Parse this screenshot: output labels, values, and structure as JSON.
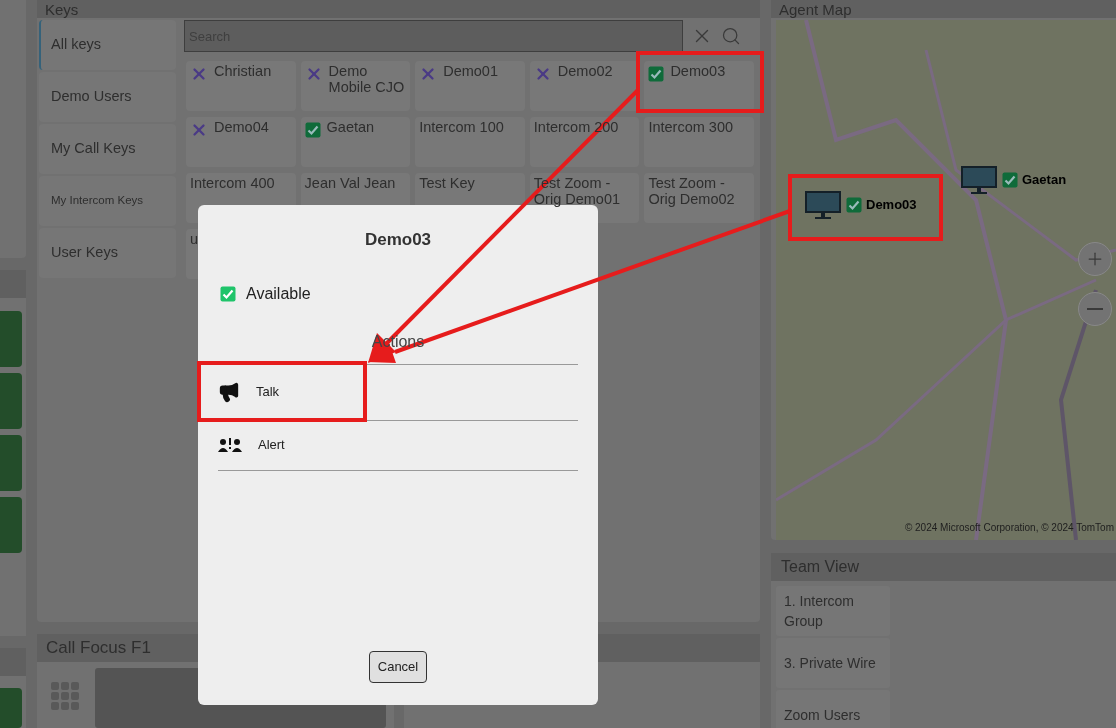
{
  "keys_panel": {
    "title": "Keys",
    "categories": [
      {
        "label": "All keys",
        "selected": true
      },
      {
        "label": "Demo Users",
        "selected": false
      },
      {
        "label": "My Call Keys",
        "selected": false
      },
      {
        "label": "My Intercom Keys",
        "selected": false
      },
      {
        "label": "User Keys",
        "selected": false
      }
    ],
    "search": {
      "placeholder": "Search"
    },
    "keys": [
      {
        "label": "Christian",
        "kind": "unavailable"
      },
      {
        "label": "Demo Mobile CJO",
        "kind": "unavailable"
      },
      {
        "label": "Demo01",
        "kind": "unavailable"
      },
      {
        "label": "Demo02",
        "kind": "unavailable"
      },
      {
        "label": "Demo03",
        "kind": "available"
      },
      {
        "label": "Demo04",
        "kind": "unavailable"
      },
      {
        "label": "Gaetan",
        "kind": "available"
      },
      {
        "label": "Intercom 100",
        "kind": "plain"
      },
      {
        "label": "Intercom 200",
        "kind": "plain"
      },
      {
        "label": "Intercom 300",
        "kind": "plain"
      },
      {
        "label": "Intercom 400",
        "kind": "plain"
      },
      {
        "label": "Jean Val Jean",
        "kind": "plain"
      },
      {
        "label": "Test Key",
        "kind": "plain"
      },
      {
        "label": "Test Zoom - Orig Demo01",
        "kind": "plain"
      },
      {
        "label": "Test Zoom - Orig Demo02",
        "kind": "plain"
      },
      {
        "label": "u",
        "kind": "plain"
      }
    ]
  },
  "call_focus": {
    "title": "Call Focus F1"
  },
  "agent_map": {
    "title": "Agent Map",
    "markers": [
      {
        "label": "Demo03",
        "available": true
      },
      {
        "label": "Gaetan",
        "available": true
      }
    ],
    "copyright": "© 2024 Microsoft Corporation, © 2024 TomTom"
  },
  "team_view": {
    "title": "Team View",
    "groups": [
      "1. Intercom Group",
      "3. Private Wire",
      "Zoom Users"
    ]
  },
  "dialog": {
    "title": "Demo03",
    "available": true,
    "available_label": "Available",
    "actions_heading": "Actions",
    "actions": [
      {
        "label": "Talk",
        "kind": "talk"
      },
      {
        "label": "Alert",
        "kind": "alert"
      }
    ],
    "cancel": "Cancel"
  }
}
